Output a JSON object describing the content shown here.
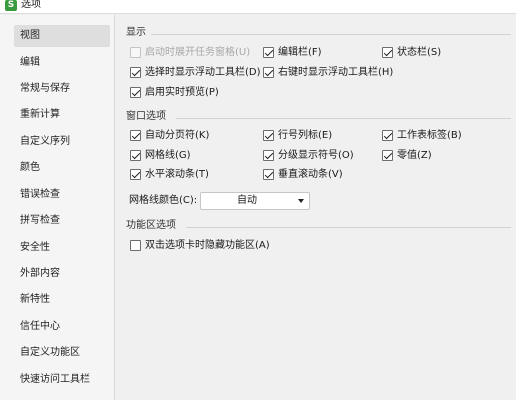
{
  "window": {
    "title": "选项",
    "icon": "app-icon"
  },
  "sidebar": {
    "items": [
      {
        "label": "视图",
        "selected": true
      },
      {
        "label": "编辑"
      },
      {
        "label": "常规与保存"
      },
      {
        "label": "重新计算"
      },
      {
        "label": "自定义序列"
      },
      {
        "label": "颜色"
      },
      {
        "label": "错误检查"
      },
      {
        "label": "拼写检查"
      },
      {
        "label": "安全性"
      },
      {
        "label": "外部内容"
      },
      {
        "label": "新特性"
      },
      {
        "label": "信任中心"
      },
      {
        "label": "自定义功能区"
      },
      {
        "label": "快速访问工具栏"
      }
    ]
  },
  "display": {
    "title": "显示",
    "options": [
      {
        "label": "启动时展开任务窗格(U)",
        "checked": false,
        "disabled": true
      },
      {
        "label": "编辑栏(F)",
        "checked": true
      },
      {
        "label": "状态栏(S)",
        "checked": true
      },
      {
        "label": "选择时显示浮动工具栏(D)",
        "checked": true
      },
      {
        "label": "右键时显示浮动工具栏(H)",
        "checked": true
      },
      {
        "label": "启用实时预览(P)",
        "checked": true
      }
    ]
  },
  "window_options": {
    "title": "窗口选项",
    "options": [
      {
        "label": "自动分页符(K)",
        "checked": true
      },
      {
        "label": "行号列标(E)",
        "checked": true
      },
      {
        "label": "工作表标签(B)",
        "checked": true
      },
      {
        "label": "网格线(G)",
        "checked": true
      },
      {
        "label": "分级显示符号(O)",
        "checked": true
      },
      {
        "label": "零值(Z)",
        "checked": true
      },
      {
        "label": "水平滚动条(T)",
        "checked": true
      },
      {
        "label": "垂直滚动条(V)",
        "checked": true
      }
    ],
    "gridline_color_label": "网格线颜色(C):",
    "gridline_color_value": "自动"
  },
  "ribbon": {
    "title": "功能区选项",
    "options": [
      {
        "label": "双击选项卡时隐藏功能区(A)",
        "checked": false
      }
    ]
  }
}
